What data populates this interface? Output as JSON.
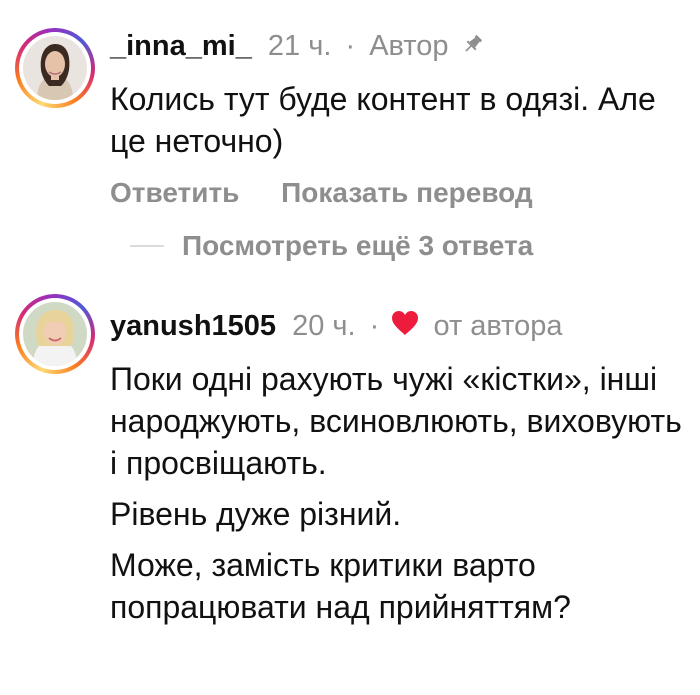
{
  "comments": [
    {
      "username": "_inna_mi_",
      "time": "21 ч.",
      "separator": "·",
      "badge": "Автор",
      "badge_icon": "pin-icon",
      "text": [
        "Колись тут буде контент в одязі. Але це неточно)"
      ],
      "actions": {
        "reply": "Ответить",
        "translate": "Показать перевод"
      },
      "more_replies": "Посмотреть ещё 3 ответа"
    },
    {
      "username": "yanush1505",
      "time": "20 ч.",
      "separator": "·",
      "liked_by": "от автора",
      "liked_icon": "heart-icon",
      "text": [
        "Поки одні рахують чужі «кістки», інші народжують, всиновлюють, виховують і просвіщають.",
        "Рівень дуже різний.",
        "Може, замість критики варто попрацювати над прийняттям?"
      ]
    }
  ],
  "colors": {
    "muted": "#8e8e8e",
    "heart": "#ed1c3c",
    "text": "#111111"
  }
}
